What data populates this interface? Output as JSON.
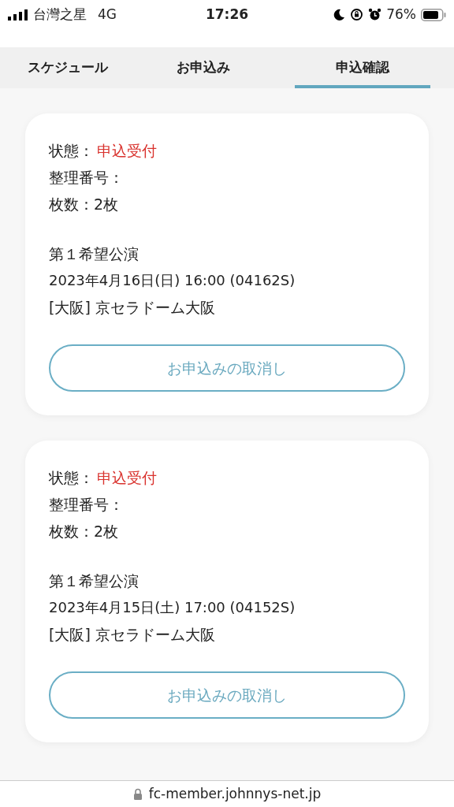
{
  "status_bar": {
    "carrier": "台灣之星",
    "network": "4G",
    "time": "17:26",
    "battery_percent": "76%"
  },
  "tabs": [
    {
      "label": "スケジュール",
      "selected": false
    },
    {
      "label": "お申込み",
      "selected": false
    },
    {
      "label": "申込確認",
      "selected": true
    }
  ],
  "applications": [
    {
      "status_label": "状態：",
      "status": "申込受付",
      "number_label": "整理番号：",
      "tickets": "枚数：2枚",
      "preference": "第１希望公演",
      "date": "2023年4月16日(日) 16:00 (04162S)",
      "venue": "[大阪] 京セラドーム大阪",
      "cancel_button": "お申込みの取消し"
    },
    {
      "status_label": "状態：",
      "status": "申込受付",
      "number_label": "整理番号：",
      "tickets": "枚数：2枚",
      "preference": "第１希望公演",
      "date": "2023年4月15日(土) 17:00 (04152S)",
      "venue": "[大阪] 京セラドーム大阪",
      "cancel_button": "お申込みの取消し"
    }
  ],
  "address_bar": {
    "url": "fc-member.johnnys-net.jp"
  }
}
